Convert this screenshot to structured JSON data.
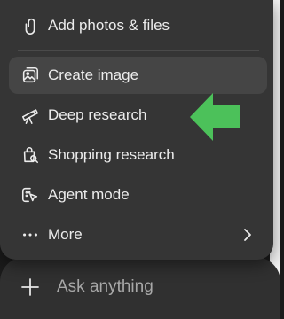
{
  "menu": {
    "items": [
      {
        "label": "Add photos & files",
        "icon": "paperclip-icon"
      },
      {
        "label": "Create image",
        "icon": "image-create-icon",
        "selected": true
      },
      {
        "label": "Deep research",
        "icon": "telescope-icon"
      },
      {
        "label": "Shopping research",
        "icon": "shopping-bag-search-icon"
      },
      {
        "label": "Agent mode",
        "icon": "agent-cursor-icon"
      },
      {
        "label": "More",
        "icon": "ellipsis-icon",
        "has_submenu": true
      }
    ]
  },
  "composer": {
    "placeholder": "Ask anything",
    "add_icon": "plus-icon"
  },
  "annotation": {
    "arrow_icon": "arrow-left-icon",
    "arrow_color": "#4cc15a",
    "points_to": "Deep research"
  },
  "colors": {
    "menu_bg": "#353535",
    "selected_bg": "#454545",
    "text": "#ececec",
    "placeholder": "#a8a8a8",
    "composer_bg": "#303030"
  }
}
